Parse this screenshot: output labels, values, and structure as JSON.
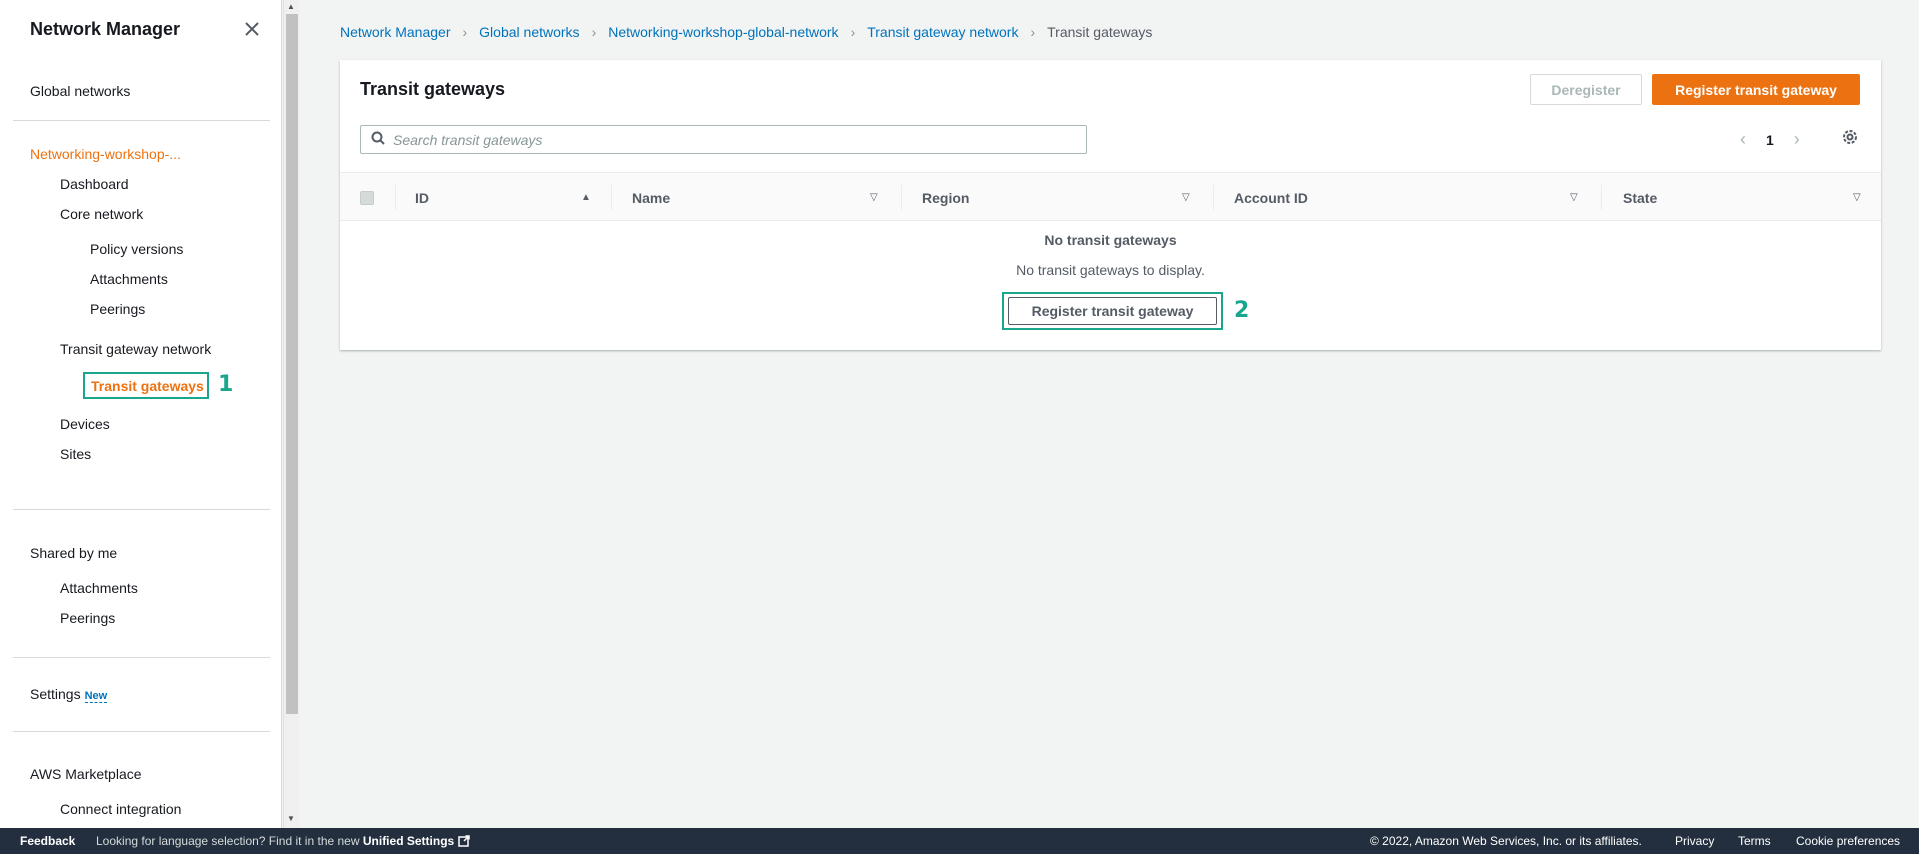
{
  "sidebar": {
    "title": "Network Manager",
    "global_networks": "Global networks",
    "network_name": "Networking-workshop-...",
    "items": {
      "dashboard": "Dashboard",
      "core_network": "Core network",
      "policy_versions": "Policy versions",
      "attachments": "Attachments",
      "peerings": "Peerings",
      "tgw_network": "Transit gateway network",
      "transit_gateways": "Transit gateways",
      "devices": "Devices",
      "sites": "Sites"
    },
    "shared_by_me": "Shared by me",
    "shared_attachments": "Attachments",
    "shared_peerings": "Peerings",
    "settings": "Settings",
    "settings_badge": "New",
    "aws_marketplace": "AWS Marketplace",
    "connect_integration": "Connect integration"
  },
  "callouts": {
    "one": "1",
    "two": "2"
  },
  "breadcrumb": [
    "Network Manager",
    "Global networks",
    "Networking-workshop-global-network",
    "Transit gateway network",
    "Transit gateways"
  ],
  "panel": {
    "title": "Transit gateways",
    "deregister": "Deregister",
    "register": "Register transit gateway",
    "search_placeholder": "Search transit gateways",
    "page": "1",
    "columns": [
      "ID",
      "Name",
      "Region",
      "Account ID",
      "State"
    ],
    "empty_title": "No transit gateways",
    "empty_sub": "No transit gateways to display.",
    "empty_button": "Register transit gateway"
  },
  "footer": {
    "feedback": "Feedback",
    "lang_prefix": "Looking for language selection? Find it in the new",
    "unified_settings": "Unified Settings",
    "copyright": "© 2022, Amazon Web Services, Inc. or its affiliates.",
    "privacy": "Privacy",
    "terms": "Terms",
    "cookies": "Cookie preferences"
  },
  "colors": {
    "accent": "#ec7211",
    "link": "#0073bb",
    "callout": "#1aa68c",
    "footer_bg": "#232f3e"
  }
}
